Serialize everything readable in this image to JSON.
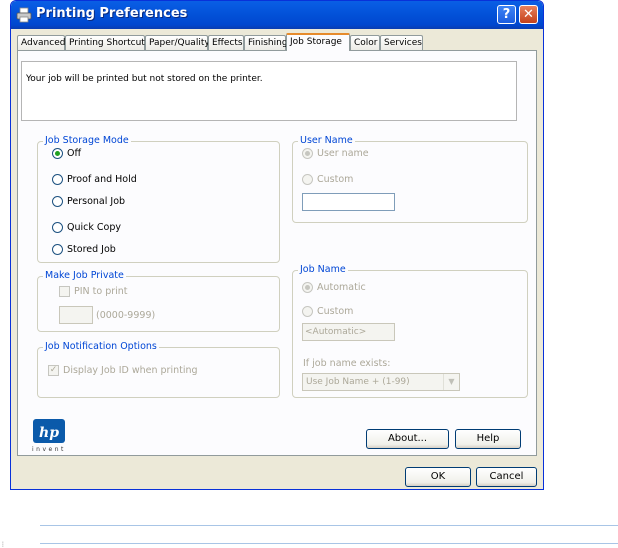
{
  "window": {
    "title": "Printing Preferences",
    "help_glyph": "?",
    "close_glyph": "✕"
  },
  "tabs": [
    "Advanced",
    "Printing Shortcuts",
    "Paper/Quality",
    "Effects",
    "Finishing",
    "Job Storage",
    "Color",
    "Services"
  ],
  "active_tab": "Job Storage",
  "message": "Your job will be printed but not stored on the printer.",
  "job_storage_mode": {
    "legend": "Job Storage Mode",
    "options": [
      "Off",
      "Proof and Hold",
      "Personal Job",
      "Quick Copy",
      "Stored Job"
    ],
    "selected": "Off"
  },
  "make_private": {
    "legend": "Make Job Private",
    "pin_label": "PIN to print",
    "pin_value": "",
    "pin_hint": "(0000-9999)"
  },
  "notification": {
    "legend": "Job Notification Options",
    "display_id_label": "Display Job ID when printing",
    "display_id_checked": true
  },
  "user_name": {
    "legend": "User Name",
    "options": [
      "User name",
      "Custom"
    ],
    "selected": "User name",
    "custom_value": ""
  },
  "job_name": {
    "legend": "Job Name",
    "options": [
      "Automatic",
      "Custom"
    ],
    "selected": "Automatic",
    "custom_value": "<Automatic>",
    "exists_label": "If job name exists:",
    "exists_value": "Use Job Name + (1-99)"
  },
  "logo": {
    "text": "invent"
  },
  "buttons": {
    "about": "About...",
    "help": "Help",
    "ok": "OK",
    "cancel": "Cancel"
  },
  "colors": {
    "accent": "#0046d5",
    "titlebar": "#0352d9",
    "selected_radio": "#21a121"
  }
}
